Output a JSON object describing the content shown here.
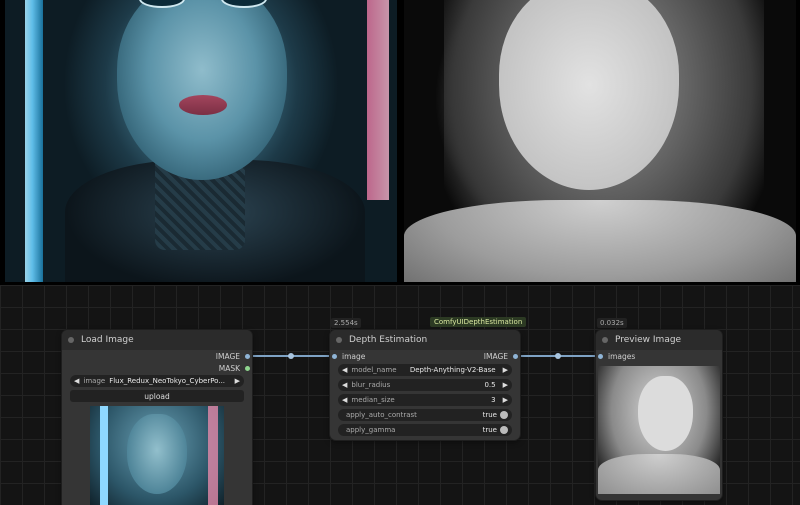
{
  "nodes": {
    "load_image": {
      "title": "Load Image",
      "outputs": [
        "IMAGE",
        "MASK"
      ],
      "image_label": "image",
      "image_value": "Flux_Redux_NeoTokyo_CyberPo...",
      "upload_label": "upload"
    },
    "depth_estimation": {
      "title": "Depth Estimation",
      "timing": "2.554s",
      "tag": "ComfyUIDepthEstimation",
      "input": "image",
      "output": "IMAGE",
      "widgets": [
        {
          "name": "model_name",
          "value": "Depth-Anything-V2-Base"
        },
        {
          "name": "blur_radius",
          "value": "0.5"
        },
        {
          "name": "median_size",
          "value": "3"
        }
      ],
      "toggles": [
        {
          "name": "apply_auto_contrast",
          "value": "true"
        },
        {
          "name": "apply_gamma",
          "value": "true"
        }
      ]
    },
    "preview_image": {
      "title": "Preview Image",
      "timing": "0.032s",
      "input": "images"
    }
  },
  "colors": {
    "canvas_bg": "#141414",
    "node_bg": "#353535",
    "node_header": "#2b2b2b",
    "image_port": "#8fb4d6",
    "mask_port": "#8fd68f",
    "wire": "#7ea2c4"
  },
  "icons": {
    "left_arrow": "◀",
    "right_arrow": "▶"
  }
}
